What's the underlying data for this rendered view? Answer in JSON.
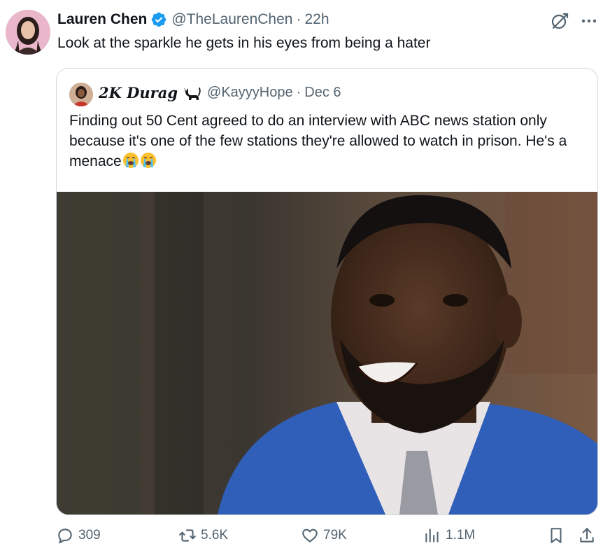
{
  "tweet": {
    "author_name": "Lauren Chen",
    "author_handle": "@TheLaurenChen",
    "separator": "·",
    "time": "22h",
    "text": "Look at the sparkle he gets in his eyes from being a hater",
    "verified_color": "#1d9bf0"
  },
  "quote": {
    "author_name": "2K Durag",
    "author_handle": "@KayyyHope",
    "separator": "·",
    "time": "Dec 6",
    "text": "Finding out 50 Cent agreed to do an interview with ABC news station only because it's one of the few stations they're allowed to watch in prison. He's a menace",
    "emojis": [
      "loudly-crying-face",
      "loudly-crying-face"
    ]
  },
  "actions": {
    "replies": "309",
    "reposts": "5.6K",
    "likes": "79K",
    "views": "1.1M"
  },
  "icons": [
    "verified-badge-icon",
    "grok-icon",
    "more-icon",
    "cat-icon",
    "reply-icon",
    "repost-icon",
    "like-icon",
    "views-icon",
    "bookmark-icon",
    "share-icon"
  ]
}
